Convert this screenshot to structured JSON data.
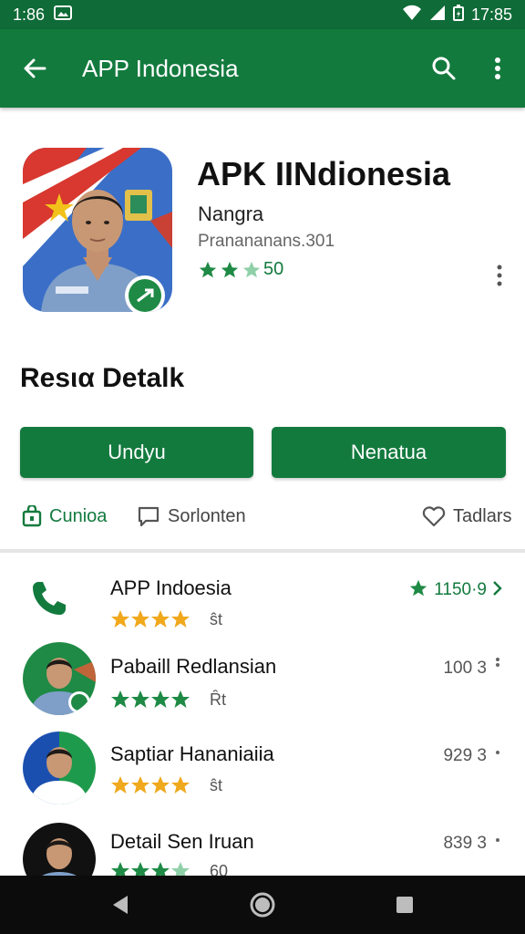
{
  "status_bar": {
    "time_left": "1:86",
    "time_right": "17:85"
  },
  "app_bar": {
    "title": "APP Indonesia"
  },
  "app": {
    "name": "APK IINdionesia",
    "developer": "Nangra",
    "meta": "Pranananans.301",
    "rating_value": "50",
    "rating_stars": 2.5
  },
  "section": {
    "title": "Resια Detalk"
  },
  "buttons": {
    "primary_label": "Undyu",
    "secondary_label": "Nenatua"
  },
  "links": [
    {
      "label": "Cunioa",
      "icon": "bag-icon"
    },
    {
      "label": "Sorlonten",
      "icon": "comment-icon"
    },
    {
      "label": "Tadlars",
      "icon": "heart-icon"
    }
  ],
  "list": [
    {
      "name": "APP Indoesia",
      "stars_text": "ŝt",
      "count": "1150·9",
      "star_color": "#f0a81c"
    },
    {
      "name": "Pabaill Redlansian",
      "stars_text": "Ȓt",
      "count": "100 3",
      "star_color": "#1e8a45"
    },
    {
      "name": "Saptiar Hananiaiia",
      "stars_text": "ŝt",
      "count": "929 3",
      "star_color": "#f0a81c"
    },
    {
      "name": "Detail Sen Iruan",
      "stars_text": "60",
      "count": "839 3",
      "star_color": "#1e8a45"
    }
  ],
  "colors": {
    "primary": "#137a3e",
    "status_bar": "#0f6b37",
    "accent_star": "#1e8a45",
    "gold_star": "#f0a81c"
  }
}
